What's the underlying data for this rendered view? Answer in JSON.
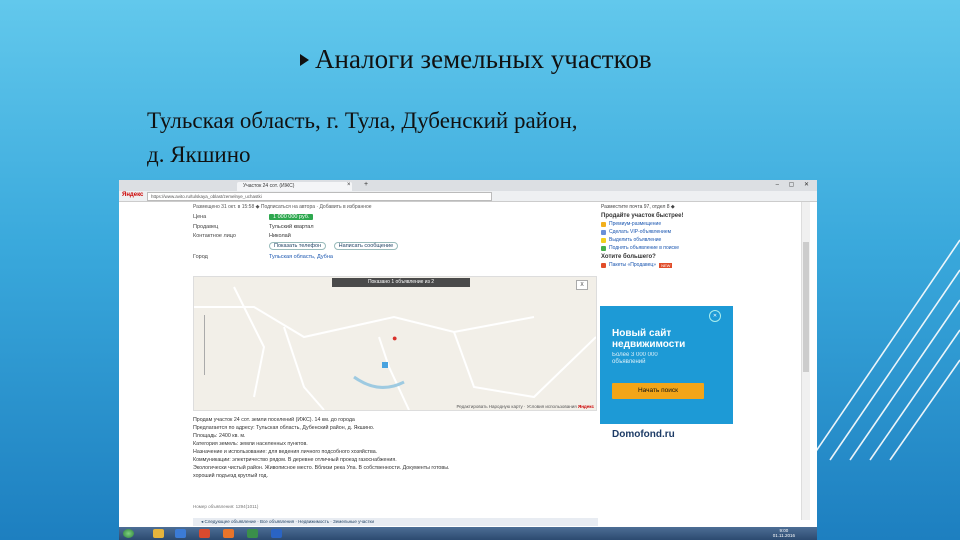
{
  "slide": {
    "title": "Аналоги земельных участков",
    "subtitle_line1": "Тульская область, г. Тула, Дубенский район,",
    "subtitle_line2": "д. Якшино"
  },
  "browser": {
    "tab_title": "Участок 24 сот. (ИЖС)",
    "yandex_label": "Яндекс",
    "url": "https://www.avito.ru/tulskaya_oblast/zemelnye_uchastki",
    "win_controls": "– ▢ ✕"
  },
  "listing": {
    "breadcrumb": "Размещено 31 окт. в 15:58   ◆ Подписаться на автора · Добавить в избранное",
    "rows": [
      {
        "label": "Цена",
        "value": "1 000 000 руб."
      },
      {
        "label": "Продавец",
        "value": "Тульский квартал"
      },
      {
        "label": "Контактное лицо",
        "value": "Николай"
      },
      {
        "label": "Город",
        "value": "Тульская область, Дубна"
      }
    ],
    "show_phone": "Показать телефон",
    "write_msg": "Написать сообщение"
  },
  "map": {
    "banner": "Показано 1 объявление из 2",
    "close": "X",
    "footer": "Редактировать Народную карту · Условия использования",
    "brand": "Яндекс"
  },
  "description": [
    "Продам участок 24 сот. земли поселений (ИЖС). 14 км. до города",
    "Предлагается по адресу: Тульская область, Дубенский район, д. Якшино.",
    "Площадь: 2400 кв. м.",
    "Категория земель: земли населенных пунктов.",
    "Назначение и использование: для ведения личного подсобного хозяйства.",
    "Коммуникации: электричество рядом. В деревне отличный проезд газоснабжения.",
    "Экологически чистый район. Живописное место. Вблизи река Упа. В собственности. Документы готовы.",
    "хороший подъезд круглый год."
  ],
  "meta": "Номер объявления: 1294(1011)",
  "sidebar": {
    "top": "Разместите  почта 97, отдел 8 ◆",
    "heading": "Продайте участок быстрее!",
    "items": [
      {
        "label": "Премиум-размещение",
        "color": "#f2b01e"
      },
      {
        "label": "Сделать VIP-объявлением",
        "color": "#6a8fd8"
      },
      {
        "label": "Выделить объявление",
        "color": "#f2d01e"
      },
      {
        "label": "Поднять объявление в поиске",
        "color": "#45b04a"
      }
    ],
    "heading2": "Хотите большего?",
    "more_item": "Пакеты «Продавец»",
    "badge": "NEW"
  },
  "ad": {
    "title_line1": "Новый сайт",
    "title_line2": "недвижимости",
    "sub_line1": "Более 3 000 000",
    "sub_line2": "объявлений",
    "button": "Начать поиск",
    "logo": "Domofond.ru",
    "close": "✕"
  },
  "bottomnav": "◂  Следующее объявление  ·  Все объявления  ·  Недвижимость  ·  Земельные участки",
  "taskbar": {
    "time": "9:00",
    "date": "01.11.2016"
  }
}
